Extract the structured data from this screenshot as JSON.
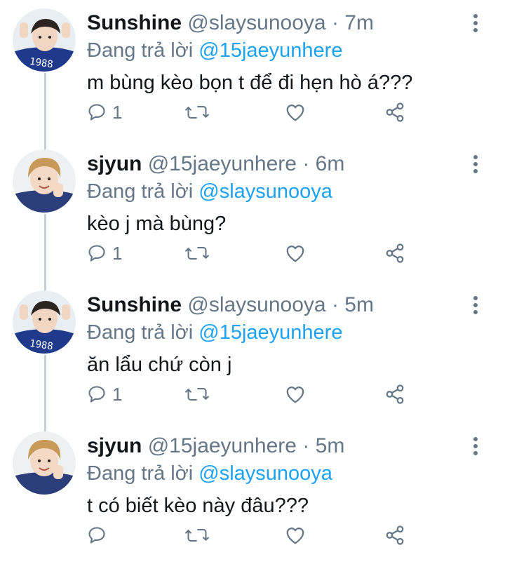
{
  "tweets": [
    {
      "name": "Sunshine",
      "handle": "@slaysunooya",
      "dot": "·",
      "time": "7m",
      "reply_prefix": "Đang trả lời",
      "reply_to": "@15jaeyunhere",
      "text": "m bùng kèo bọn t để đi hẹn hò á???",
      "reply_count": "1",
      "avatar": "avatar-sunshine"
    },
    {
      "name": "sjyun",
      "handle": "@15jaeyunhere",
      "dot": "·",
      "time": "6m",
      "reply_prefix": "Đang trả lời",
      "reply_to": "@slaysunooya",
      "text": "kèo j mà bùng?",
      "reply_count": "1",
      "avatar": "avatar-sjyun"
    },
    {
      "name": "Sunshine",
      "handle": "@slaysunooya",
      "dot": "·",
      "time": "5m",
      "reply_prefix": "Đang trả lời",
      "reply_to": "@15jaeyunhere",
      "text": "ăn lẩu chứ còn j",
      "reply_count": "1",
      "avatar": "avatar-sunshine"
    },
    {
      "name": "sjyun",
      "handle": "@15jaeyunhere",
      "dot": "·",
      "time": "5m",
      "reply_prefix": "Đang trả lời",
      "reply_to": "@slaysunooya",
      "text": "t có biết kèo này đâu???",
      "reply_count": "",
      "avatar": "avatar-sjyun"
    }
  ],
  "colors": {
    "accent": "#1da1f2",
    "secondary_text": "#657786",
    "primary_text": "#14171a",
    "thread_line": "#c4cfd6"
  },
  "icons": [
    "reply-icon",
    "retweet-icon",
    "like-icon",
    "share-icon",
    "more-icon"
  ]
}
